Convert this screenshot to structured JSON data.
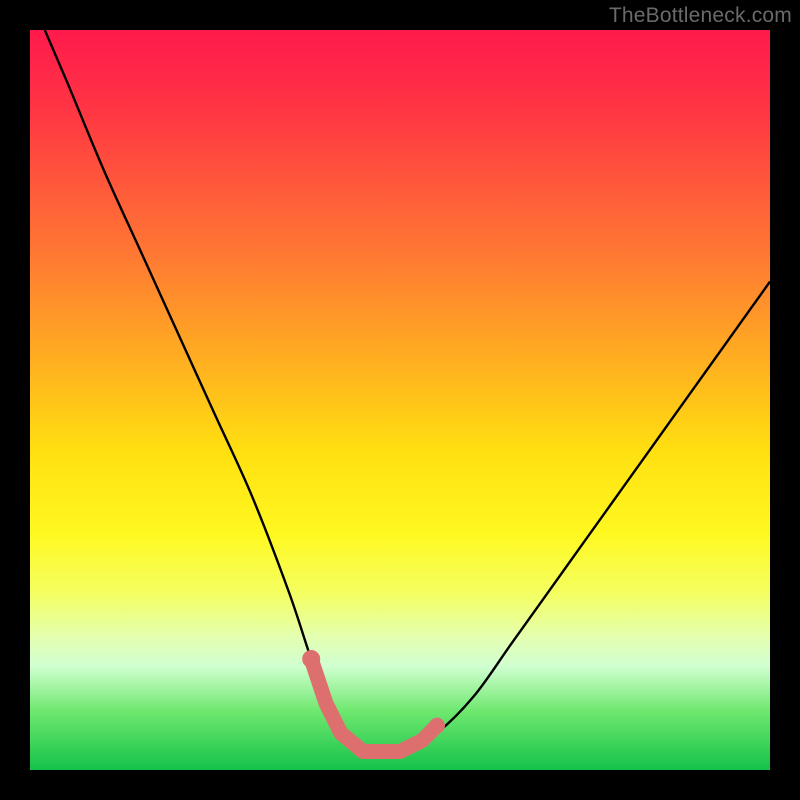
{
  "watermark": "TheBottleneck.com",
  "chart_data": {
    "type": "line",
    "title": "",
    "xlabel": "",
    "ylabel": "",
    "xlim": [
      0,
      100
    ],
    "ylim": [
      0,
      100
    ],
    "series": [
      {
        "name": "bottleneck-curve",
        "x": [
          2,
          5,
          10,
          15,
          20,
          25,
          30,
          35,
          38,
          40,
          42,
          45,
          48,
          50,
          55,
          60,
          65,
          70,
          75,
          80,
          85,
          90,
          95,
          100
        ],
        "values": [
          100,
          93,
          81,
          70,
          59,
          48,
          37,
          24,
          15,
          10,
          5,
          2,
          2,
          2,
          5,
          10,
          17,
          24,
          31,
          38,
          45,
          52,
          59,
          66
        ]
      }
    ],
    "optimal_segment": {
      "name": "optimal-range-marker",
      "color": "#dd6f6f",
      "points_x": [
        38,
        40,
        42,
        45,
        48,
        50,
        53,
        55
      ],
      "points_y": [
        15,
        9,
        5,
        2.5,
        2.5,
        2.5,
        4,
        6
      ]
    }
  }
}
